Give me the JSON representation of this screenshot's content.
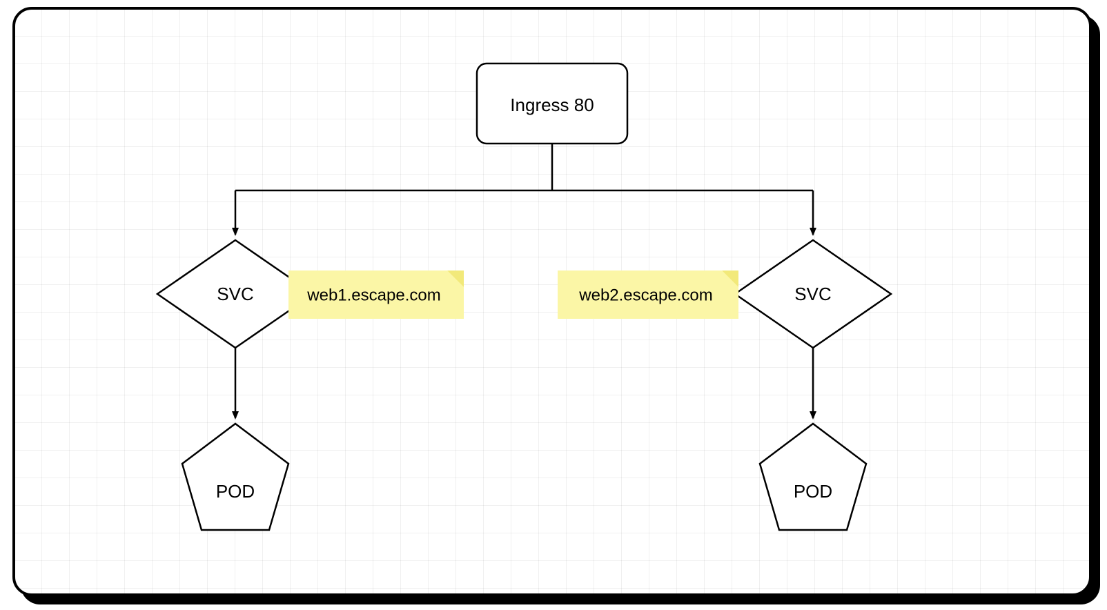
{
  "nodes": {
    "ingress": {
      "label": "Ingress 80"
    },
    "svc_left": {
      "label": "SVC"
    },
    "svc_right": {
      "label": "SVC"
    },
    "pod_left": {
      "label": "POD"
    },
    "pod_right": {
      "label": "POD"
    }
  },
  "notes": {
    "host_left": {
      "label": "web1.escape.com"
    },
    "host_right": {
      "label": "web2.escape.com"
    }
  },
  "colors": {
    "note_fill": "#fbf6a6",
    "note_fold": "#f2e97a",
    "stroke": "#000000"
  }
}
